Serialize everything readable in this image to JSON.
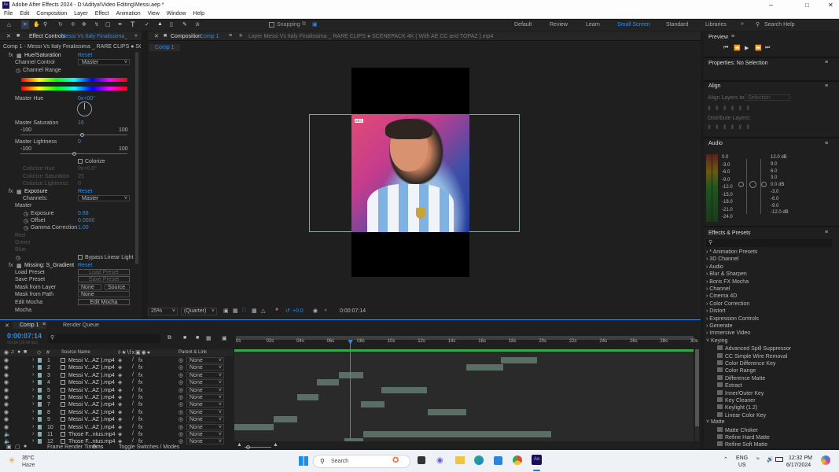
{
  "titlebar": {
    "title": "Adobe After Effects 2024 - D:\\Aditya\\Video Editing\\Messi.aep *"
  },
  "menu": [
    "File",
    "Edit",
    "Composition",
    "Layer",
    "Effect",
    "Animation",
    "View",
    "Window",
    "Help"
  ],
  "workspaces": {
    "snapping": "Snapping",
    "items": [
      "Default",
      "Review",
      "Learn",
      "Small Screen",
      "Standard",
      "Libraries"
    ],
    "active": "Small Screen",
    "search": "Search Help"
  },
  "effect_controls": {
    "tab": "Effect Controls",
    "layer_link": "Messi Vs Italy Finalissima_",
    "breadcrumb": "Comp 1 - Messi Vs Italy Finalissima _ RARE CLIPS ● SCENEPAC",
    "lines": [
      {
        "t": "Hue/Saturation",
        "v": "Reset"
      },
      {
        "t": "Channel Control",
        "v": "Master"
      },
      {
        "t": "Channel Range",
        "v": ""
      },
      {
        "t": "Master Hue",
        "v": "0x+00°"
      },
      {
        "t": "Master Saturation",
        "v": "16"
      },
      {
        "t": "-100",
        "v": "100"
      },
      {
        "t": "Master Lightness",
        "v": "0"
      },
      {
        "t": "-100",
        "v": "100"
      },
      {
        "t": "Colorize",
        "v": ""
      },
      {
        "t": "Colorize Hue",
        "v": "0x+0.0°"
      },
      {
        "t": "Colorize Saturation",
        "v": "25"
      },
      {
        "t": "Colorize Lightness",
        "v": "0"
      },
      {
        "t": "Exposure",
        "v": "Reset"
      },
      {
        "t": "Channels:",
        "v": "Master"
      },
      {
        "t": "Master",
        "v": ""
      },
      {
        "t": "Exposure",
        "v": "0.88"
      },
      {
        "t": "Offset",
        "v": "0.0000"
      },
      {
        "t": "Gamma Correction",
        "v": "1.00"
      },
      {
        "t": "Red",
        "v": ""
      },
      {
        "t": "Green",
        "v": ""
      },
      {
        "t": "Blue",
        "v": ""
      },
      {
        "t": "Bypass Linear Light",
        "v": ""
      },
      {
        "t": "Missing: S_Gradient",
        "v": "Reset"
      },
      {
        "t": "Load Preset",
        "v": "Load Preset"
      },
      {
        "t": "Save Preset",
        "v": "Save Preset"
      },
      {
        "t": "Mask from Layer",
        "v": "None"
      },
      {
        "t": "Mask from Path",
        "v": "None"
      },
      {
        "t": "Edit Mocha",
        "v": "Edit Mocha"
      },
      {
        "t": "Mocha",
        "v": ""
      }
    ],
    "source": "Source"
  },
  "composition": {
    "tab": "Composition",
    "comp_link": "Comp 1",
    "layer_tab": "Layer  Messi Vs Italy Finalissima _ RARE CLIPS ● SCENEPACK 4K ( With AE CC and TOPAZ ).mp4",
    "subtab": "Comp 1",
    "zoom": "25%",
    "resolution": "(Quarter)",
    "exposure": "+0.0",
    "timecode": "0:00:07:14",
    "badge": "ARG"
  },
  "right": {
    "preview": "Preview",
    "properties": "Properties: No Selection",
    "align": "Align",
    "align_to": "Align Layers to:",
    "align_to_value": "Selection",
    "distribute": "Distribute Layers:",
    "audio": "Audio",
    "audio_left": [
      "0.0",
      "-3.0",
      "-6.0",
      "-9.0",
      "-12.0",
      "-15.0",
      "-18.0",
      "-21.0",
      "-24.0"
    ],
    "audio_right": [
      "12.0 dB",
      "9.0",
      "6.0",
      "3.0",
      "0.0 dB",
      "-3.0",
      "-6.0",
      "-9.0",
      "-12.0 dB"
    ],
    "effects": "Effects & Presets",
    "categories": [
      "* Animation Presets",
      "3D Channel",
      "Audio",
      "Blur & Sharpen",
      "Boris FX Mocha",
      "Channel",
      "Cinema 4D",
      "Color Correction",
      "Distort",
      "Expression Controls",
      "Generate",
      "Immersive Video",
      "Keying"
    ],
    "keying": [
      "Advanced Spill Suppressor",
      "CC Simple Wire Removal",
      "Color Difference Key",
      "Color Range",
      "Difference Matte",
      "Extract",
      "Inner/Outer Key",
      "Key Cleaner",
      "Keylight (1.2)",
      "Linear Color Key"
    ],
    "matte_cat": "Matte",
    "matte": [
      "Matte Choker",
      "Refine Hard Matte",
      "Refine Soft Matte"
    ]
  },
  "timeline": {
    "tab": "Comp 1",
    "render_queue": "Render Queue",
    "timecode": "0:00:07:14",
    "fps": "00194 (25.00 fps)",
    "col_num": "#",
    "col_source": "Source Name",
    "col_parent": "Parent & Link",
    "ticks": [
      "0s",
      "02s",
      "04s",
      "06s",
      "08s",
      "10s",
      "12s",
      "14s",
      "16s",
      "18s",
      "20s",
      "22s",
      "24s",
      "26s",
      "28s",
      "30s"
    ],
    "layers": [
      {
        "n": "1",
        "name": "Messi V...AZ ).mp4",
        "p": "None",
        "s": 0.58,
        "e": 0.66
      },
      {
        "n": "2",
        "name": "Messi V...AZ ).mp4",
        "p": "None",
        "s": 0.505,
        "e": 0.585
      },
      {
        "n": "3",
        "name": "Messi V...AZ ).mp4",
        "p": "None",
        "s": 0.228,
        "e": 0.28
      },
      {
        "n": "4",
        "name": "Messi V...AZ ).mp4",
        "p": "None",
        "s": 0.18,
        "e": 0.228
      },
      {
        "n": "5",
        "name": "Messi V...AZ ).mp4",
        "p": "None",
        "s": 0.32,
        "e": 0.42
      },
      {
        "n": "6",
        "name": "Messi V...AZ ).mp4",
        "p": "None",
        "s": 0.137,
        "e": 0.183
      },
      {
        "n": "7",
        "name": "Messi V...AZ ).mp4",
        "p": "None",
        "s": 0.275,
        "e": 0.327
      },
      {
        "n": "8",
        "name": "Messi V...AZ ).mp4",
        "p": "None",
        "s": 0.422,
        "e": 0.505
      },
      {
        "n": "9",
        "name": "Messi V...AZ ).mp4",
        "p": "None",
        "s": 0.085,
        "e": 0.137
      },
      {
        "n": "10",
        "name": "Messi V...AZ ).mp4",
        "p": "None",
        "s": 0.0,
        "e": 0.085
      },
      {
        "n": "11",
        "name": "Those F...ntus.mp4",
        "p": "None",
        "s": 0.28,
        "e": 0.69
      },
      {
        "n": "12",
        "name": "Those F...ntus.mp4",
        "p": "None",
        "s": 0.24,
        "e": 0.28
      }
    ],
    "playhead": 0.252,
    "frame_render": "Frame Render Time",
    "render_ms": "0ms",
    "toggle": "Toggle Switches / Modes"
  },
  "taskbar": {
    "temp": "35°C",
    "weather": "Haze",
    "search": "Search",
    "lang1": "ENG",
    "lang2": "US",
    "time": "12:32 PM",
    "date": "6/17/2024"
  }
}
